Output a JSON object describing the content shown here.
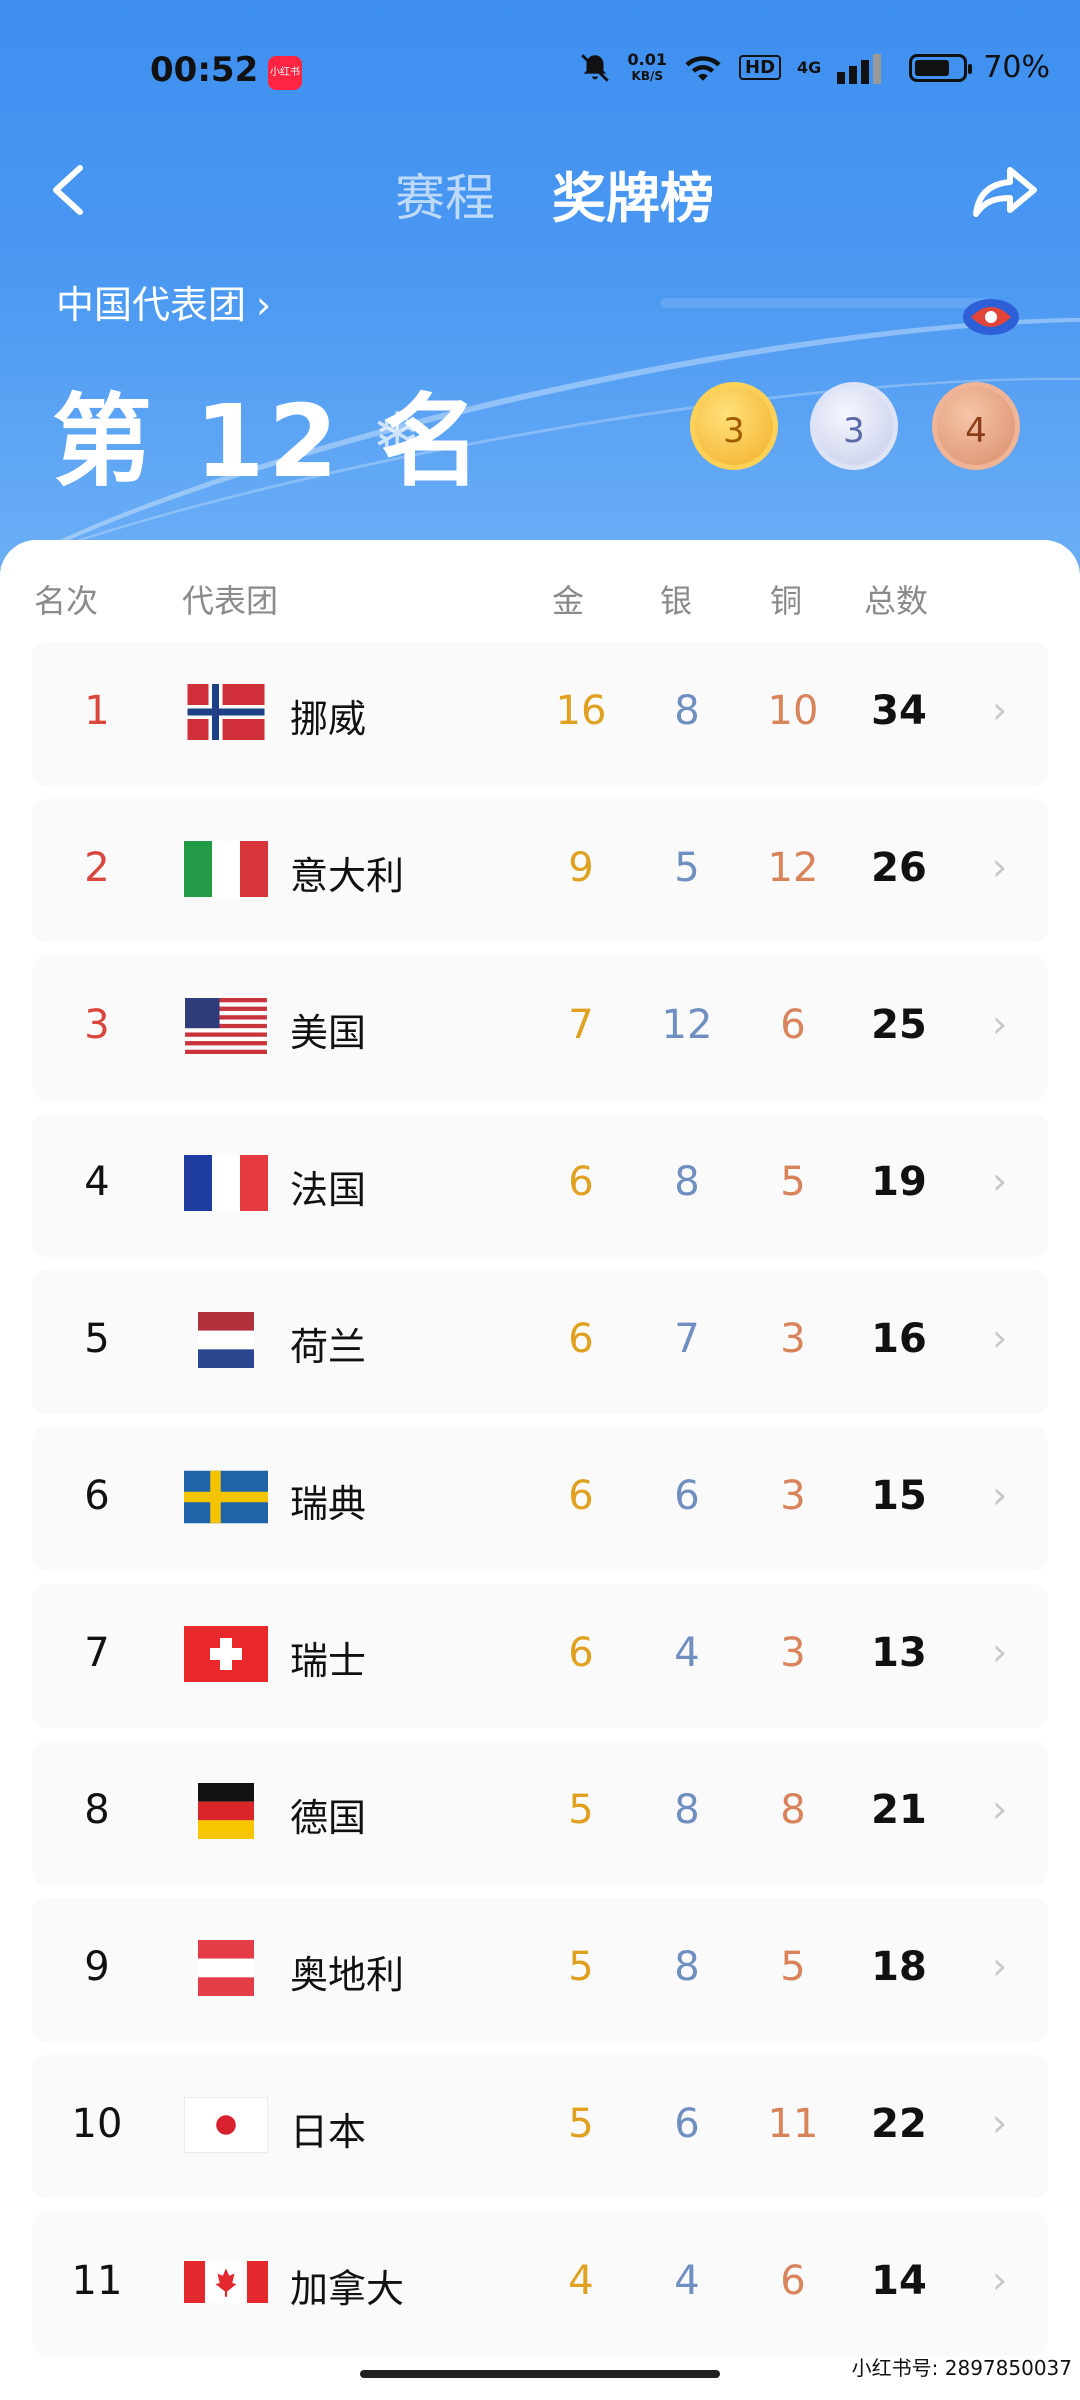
{
  "status": {
    "time": "00:52",
    "app_badge": "小红书",
    "net_speed": "0.01",
    "net_unit": "KB/S",
    "hd": "HD",
    "signal": "4G",
    "battery": "70%"
  },
  "nav": {
    "tab_schedule": "赛程",
    "tab_medals": "奖牌榜"
  },
  "team": {
    "link_label": "中国代表团",
    "chevron": "›",
    "rank_text": "第 12 名",
    "snow": "❄",
    "gold": "3",
    "silver": "3",
    "bronze": "4"
  },
  "headers": {
    "rank": "名次",
    "team": "代表团",
    "gold": "金",
    "silver": "银",
    "bronze": "铜",
    "total": "总数"
  },
  "rows": [
    {
      "rank": "1",
      "name": "挪威",
      "flag": "norway-flag",
      "gold": "16",
      "silver": "8",
      "bronze": "10",
      "total": "34"
    },
    {
      "rank": "2",
      "name": "意大利",
      "flag": "italy-flag",
      "gold": "9",
      "silver": "5",
      "bronze": "12",
      "total": "26"
    },
    {
      "rank": "3",
      "name": "美国",
      "flag": "usa-flag",
      "gold": "7",
      "silver": "12",
      "bronze": "6",
      "total": "25"
    },
    {
      "rank": "4",
      "name": "法国",
      "flag": "france-flag",
      "gold": "6",
      "silver": "8",
      "bronze": "5",
      "total": "19"
    },
    {
      "rank": "5",
      "name": "荷兰",
      "flag": "netherlands-flag",
      "gold": "6",
      "silver": "7",
      "bronze": "3",
      "total": "16"
    },
    {
      "rank": "6",
      "name": "瑞典",
      "flag": "sweden-flag",
      "gold": "6",
      "silver": "6",
      "bronze": "3",
      "total": "15"
    },
    {
      "rank": "7",
      "name": "瑞士",
      "flag": "switzerland-flag",
      "gold": "6",
      "silver": "4",
      "bronze": "3",
      "total": "13"
    },
    {
      "rank": "8",
      "name": "德国",
      "flag": "germany-flag",
      "gold": "5",
      "silver": "8",
      "bronze": "8",
      "total": "21"
    },
    {
      "rank": "9",
      "name": "奥地利",
      "flag": "austria-flag",
      "gold": "5",
      "silver": "8",
      "bronze": "5",
      "total": "18"
    },
    {
      "rank": "10",
      "name": "日本",
      "flag": "japan-flag",
      "gold": "5",
      "silver": "6",
      "bronze": "11",
      "total": "22"
    },
    {
      "rank": "11",
      "name": "加拿大",
      "flag": "canada-flag",
      "gold": "4",
      "silver": "4",
      "bronze": "6",
      "total": "14"
    }
  ],
  "row_chevron": "›",
  "watermark": "小红书号: 2897850037",
  "colors": {
    "hero_blue": "#3e8ff0",
    "gold_text": "#e0a020",
    "silver_text": "#6f8fc0",
    "bronze_text": "#d9835a",
    "top_rank": "#d9463b"
  }
}
